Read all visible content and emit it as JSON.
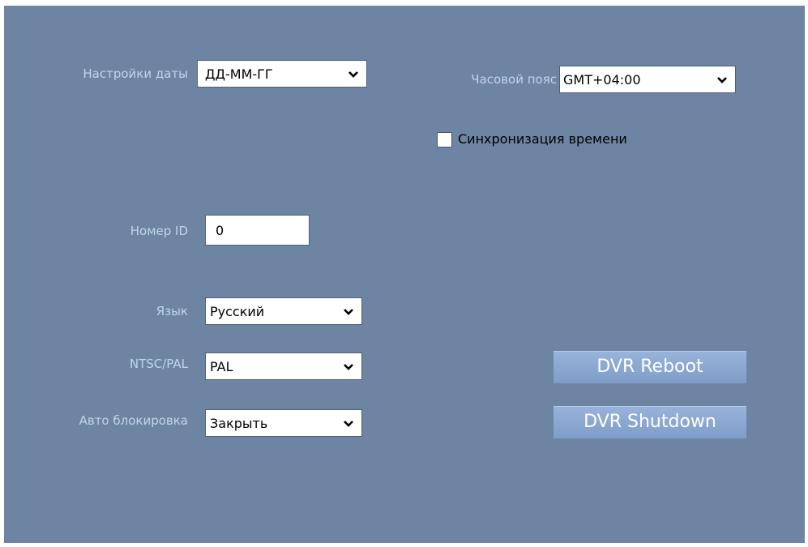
{
  "date_settings": {
    "label": "Настройки даты",
    "value": "ДД-ММ-ГГ"
  },
  "timezone": {
    "label": "Часовой пояс",
    "value": "GMT+04:00"
  },
  "time_sync": {
    "label": "Синхронизация времени",
    "checked": false
  },
  "device_id": {
    "label": "Номер ID",
    "value": "0"
  },
  "language": {
    "label": "Язык",
    "value": "Русский"
  },
  "video_standard": {
    "label": "NTSC/PAL",
    "value": "PAL"
  },
  "auto_lock": {
    "label": "Авто блокировка",
    "value": "Закрыть"
  },
  "buttons": {
    "reboot": "DVR Reboot",
    "shutdown": "DVR Shutdown"
  },
  "colors": {
    "panel": "#6e84a3",
    "label": "#c4d3ea",
    "button": "#8aa8d3"
  },
  "icons": {
    "dropdown": "chevron-down-icon"
  }
}
